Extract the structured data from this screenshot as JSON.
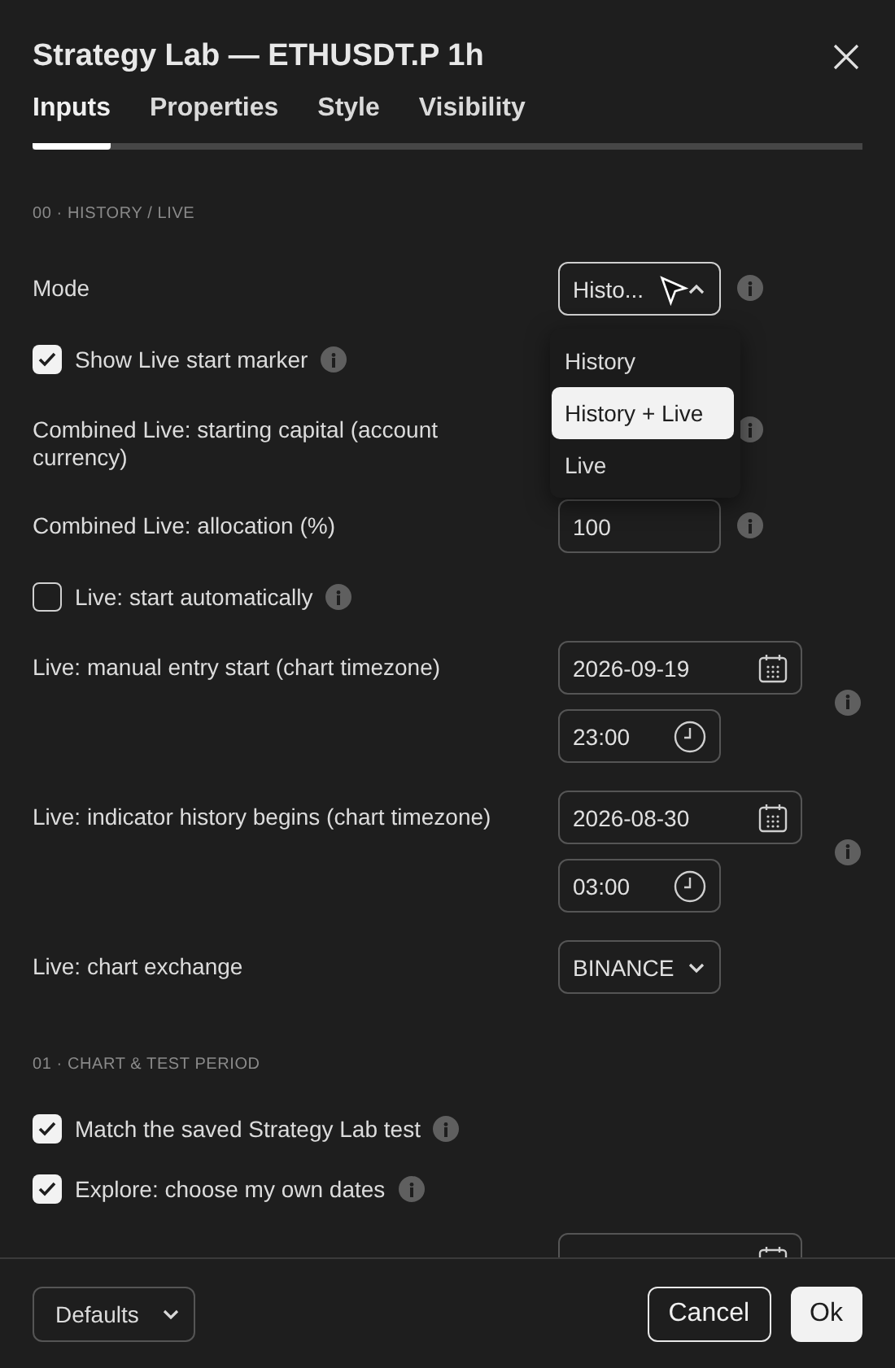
{
  "title": "Strategy Lab — ETHUSDT.P 1h",
  "tabs": [
    {
      "label": "Inputs",
      "selected": true
    },
    {
      "label": "Properties",
      "selected": false
    },
    {
      "label": "Style",
      "selected": false
    },
    {
      "label": "Visibility",
      "selected": false
    }
  ],
  "sections": [
    {
      "heading": "00 · HISTORY / LIVE",
      "rows": [
        {
          "kind": "select",
          "label": "Mode",
          "value": "Histo...",
          "open": true,
          "info": true,
          "options": [
            {
              "label": "History",
              "selected": false
            },
            {
              "label": "History + Live",
              "selected": true
            },
            {
              "label": "Live",
              "selected": false
            }
          ]
        },
        {
          "kind": "checkbox",
          "label": "Show Live start marker",
          "checked": true,
          "info": true
        },
        {
          "kind": "number",
          "label": "Combined Live: starting capital (account currency)",
          "info": true
        },
        {
          "kind": "number",
          "label": "Combined Live: allocation (%)",
          "value": "100",
          "info": true
        },
        {
          "kind": "checkbox",
          "label": "Live: start automatically",
          "checked": false,
          "info": true
        },
        {
          "kind": "datetime",
          "label": "Live: manual entry start (chart timezone)",
          "date": "2026-09-19",
          "time": "23:00",
          "info": true
        },
        {
          "kind": "datetime",
          "label": "Live: indicator history begins (chart timezone)",
          "date": "2026-08-30",
          "time": "03:00",
          "info": true
        },
        {
          "kind": "select",
          "label": "Live: chart exchange",
          "value": "BINANCE",
          "open": false,
          "info": false
        }
      ]
    },
    {
      "heading": "01 · CHART & TEST PERIOD",
      "rows": [
        {
          "kind": "checkbox",
          "label": "Match the saved Strategy Lab test",
          "checked": true,
          "info": true
        },
        {
          "kind": "checkbox",
          "label": "Explore: choose my own dates",
          "checked": true,
          "info": true
        },
        {
          "kind": "cut"
        }
      ]
    }
  ],
  "footer": {
    "defaults": "Defaults",
    "cancel": "Cancel",
    "ok": "Ok"
  }
}
